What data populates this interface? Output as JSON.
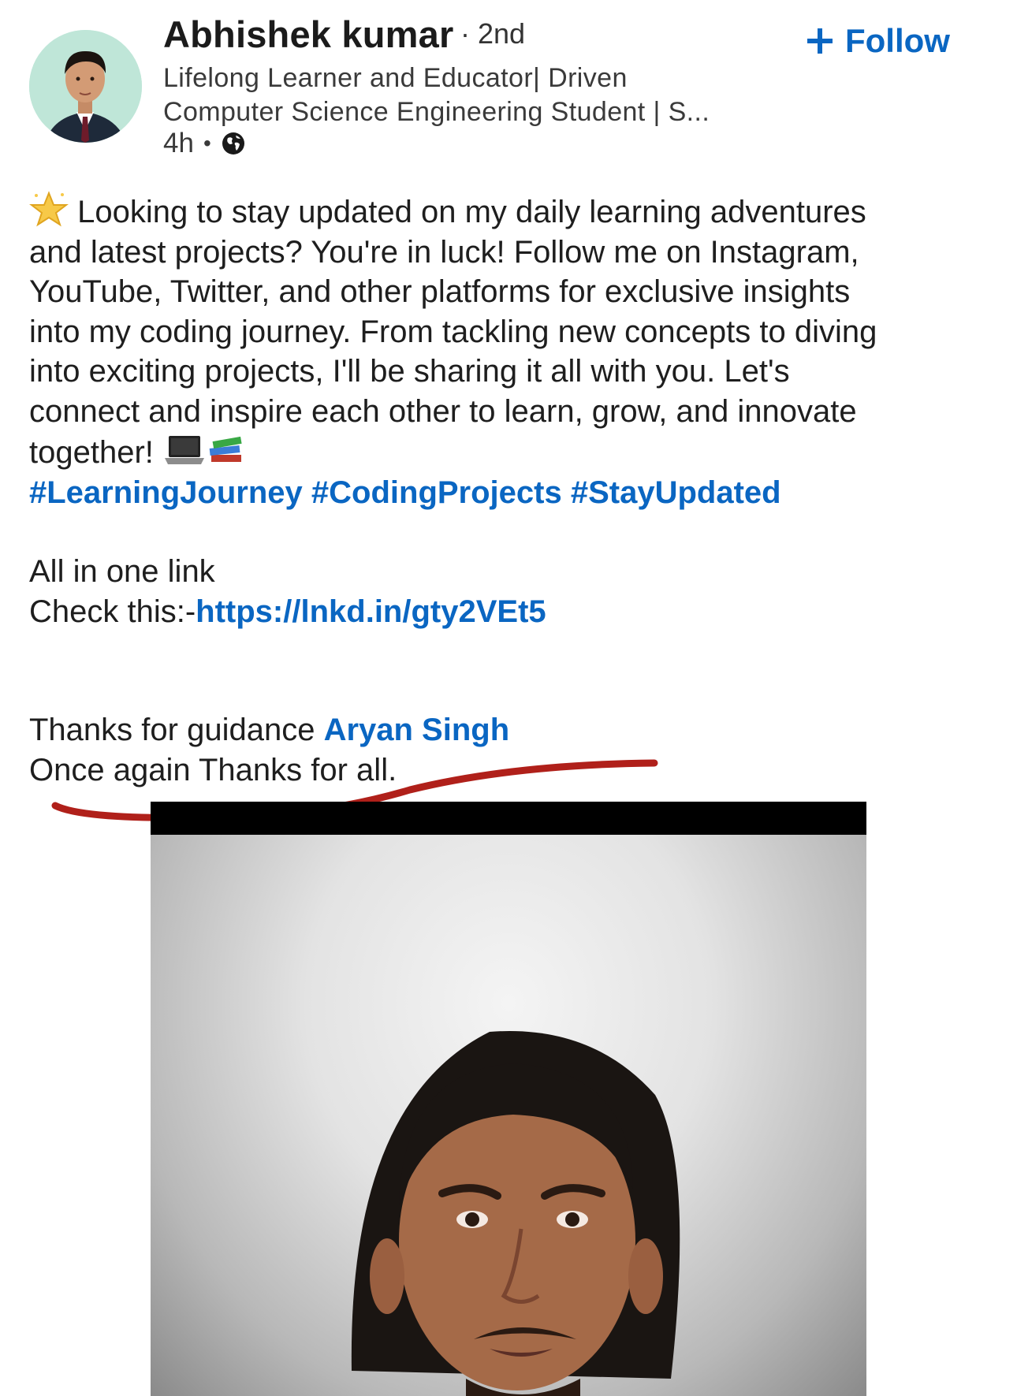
{
  "author": {
    "name": "Abhishek kumar",
    "connection_degree": "2nd",
    "headline_lines": [
      "Lifelong Learner and Educator| Driven",
      "Computer Science Engineering Student | S..."
    ],
    "time_ago": "4h"
  },
  "follow_button": {
    "label": "Follow",
    "color": "#0a66c2"
  },
  "post": {
    "text_lines": [
      "Looking to stay updated on my daily learning adventures",
      "and latest projects? You're in luck! Follow me on Instagram,",
      "YouTube, Twitter, and other platforms for exclusive insights",
      "into my coding journey. From tackling new concepts to diving",
      "into exciting projects, I'll be sharing it all with you. Let's",
      "connect and inspire each other to learn, grow, and innovate",
      "together!"
    ],
    "hashtags": [
      "#LearningJourney",
      "#CodingProjects",
      "#StayUpdated"
    ],
    "all_in_one": "All in one link",
    "check_prefix": "Check this:-",
    "link": "https://lnkd.in/gty2VEt5",
    "thanks_prefix": "Thanks for guidance ",
    "mention": "Aryan Singh",
    "closing": "Once again Thanks for all."
  },
  "icons": [
    "star-emoji-icon",
    "laptop-emoji-icon",
    "books-emoji-icon",
    "globe-icon",
    "plus-icon"
  ],
  "annotation_color": "#b0201a"
}
